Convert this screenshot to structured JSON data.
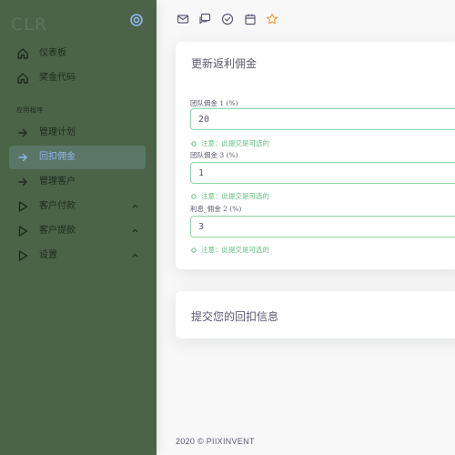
{
  "sidebar": {
    "brand": "CLR",
    "items_top": [
      {
        "label": "仪表板",
        "icon": "home-icon"
      },
      {
        "label": "奖金代码",
        "icon": "home-icon"
      }
    ],
    "section_header": "应用程序",
    "items_app": [
      {
        "label": "管理计划",
        "icon": "arrow-right-icon",
        "active": false
      },
      {
        "label": "回扣佣金",
        "icon": "arrow-right-icon",
        "active": true
      },
      {
        "label": "管理客户",
        "icon": "arrow-right-icon",
        "active": false
      },
      {
        "label": "客户付款",
        "icon": "play-icon",
        "expandable": true
      },
      {
        "label": "客户提款",
        "icon": "play-icon",
        "expandable": true
      },
      {
        "label": "设置",
        "icon": "play-icon",
        "expandable": true
      }
    ]
  },
  "navbar": {
    "icons": [
      "mail-icon",
      "chat-icon",
      "check-circle-icon",
      "calendar-icon",
      "star-icon"
    ]
  },
  "update_card": {
    "title": "更新返利佣金",
    "fields": [
      {
        "label": "团队佣金 1 (%)",
        "value": "20",
        "hint": "注意：此提交是可选的"
      },
      {
        "label": "团队佣金 3 (%)",
        "value": "1",
        "hint": "注意：此提交是可选的"
      },
      {
        "label": "利息_佣金 2 (%)",
        "value": "3",
        "hint": "注意：此提交是可选的"
      }
    ]
  },
  "submit_card": {
    "title": "提交您的回扣信息"
  },
  "footer": {
    "copyright": "2020 © PIIXINVENT"
  },
  "colors": {
    "sidebar_bg": "#4b6447",
    "active_bg": "#5b7566",
    "active_text": "#8fb6f0",
    "accent_green": "#5fbf7f",
    "star": "#ff9f43"
  }
}
